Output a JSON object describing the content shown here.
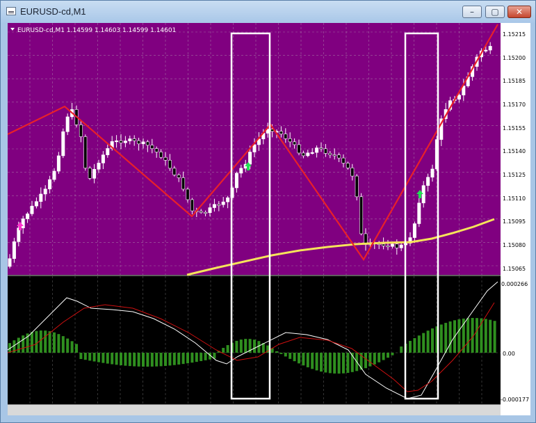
{
  "window": {
    "title": "EURUSD-cd,M1",
    "controls": {
      "minimize": "–",
      "maximize": "▢",
      "close": "✕"
    }
  },
  "chart": {
    "header_label": "EURUSD-cd,M1  1.14599 1.14603 1.14599 1.14601",
    "price_axis": [
      "1.15215",
      "1.15200",
      "1.15185",
      "1.15170",
      "1.15155",
      "1.15140",
      "1.15125",
      "1.15110",
      "1.15095",
      "1.15080",
      "1.15065"
    ],
    "indicator_axis": [
      "0.000266",
      "0.00",
      "-0.000177"
    ],
    "colors": {
      "main_background": "#800080",
      "indicator_background": "#000000",
      "grid": "#c0c0c0",
      "zigzag": "#e8202a",
      "moving_average": "#f5e35a",
      "macd_line": "#ffffff",
      "signal_line": "#d01010",
      "histogram": "#2f8f1f",
      "buy_arrow": "#22e055",
      "sell_arrow": "#ff33cc",
      "highlight_box": "#ffffff"
    }
  }
}
